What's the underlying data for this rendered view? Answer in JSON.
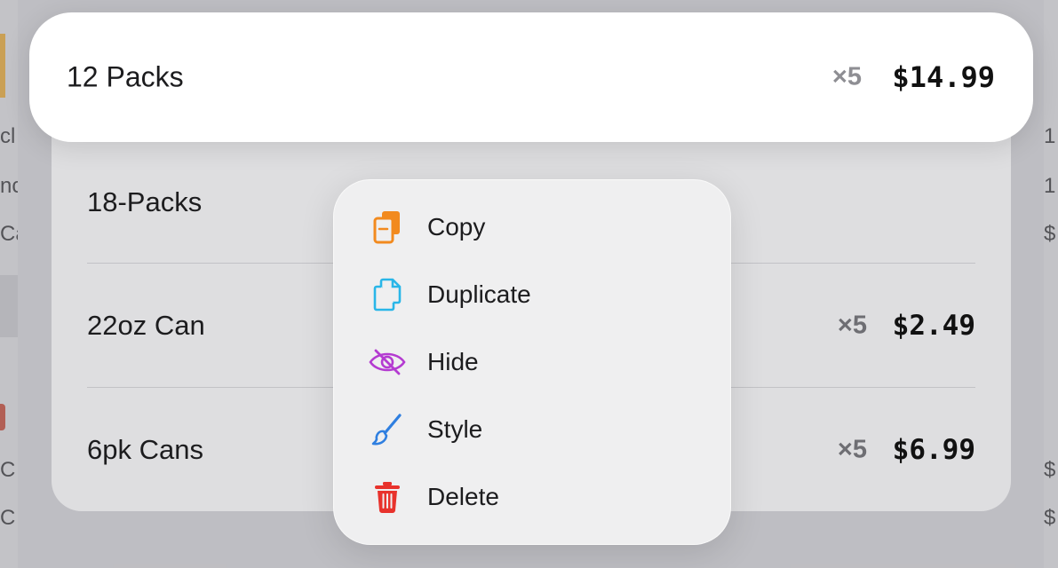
{
  "edges": {
    "left": [
      "cl",
      "nc",
      "Ca",
      "C",
      "C"
    ],
    "right": [
      "1",
      "1",
      "$",
      "$",
      "$"
    ]
  },
  "selected": {
    "name": "12 Packs",
    "qty": "×5",
    "price": "$14.99"
  },
  "rows": [
    {
      "name": "18-Packs",
      "qty": "",
      "price": ""
    },
    {
      "name": "22oz Can",
      "qty": "×5",
      "price": "$2.49"
    },
    {
      "name": "6pk Cans",
      "qty": "×5",
      "price": "$6.99"
    }
  ],
  "menu": [
    {
      "label": "Copy",
      "icon": "copy-icon",
      "color": "#f28a1e"
    },
    {
      "label": "Duplicate",
      "icon": "duplicate-icon",
      "color": "#29b6e8"
    },
    {
      "label": "Hide",
      "icon": "eye-slash-icon",
      "color": "#b43bd1"
    },
    {
      "label": "Style",
      "icon": "paintbrush-icon",
      "color": "#2f7fe0"
    },
    {
      "label": "Delete",
      "icon": "trash-icon",
      "color": "#e8322c"
    }
  ]
}
